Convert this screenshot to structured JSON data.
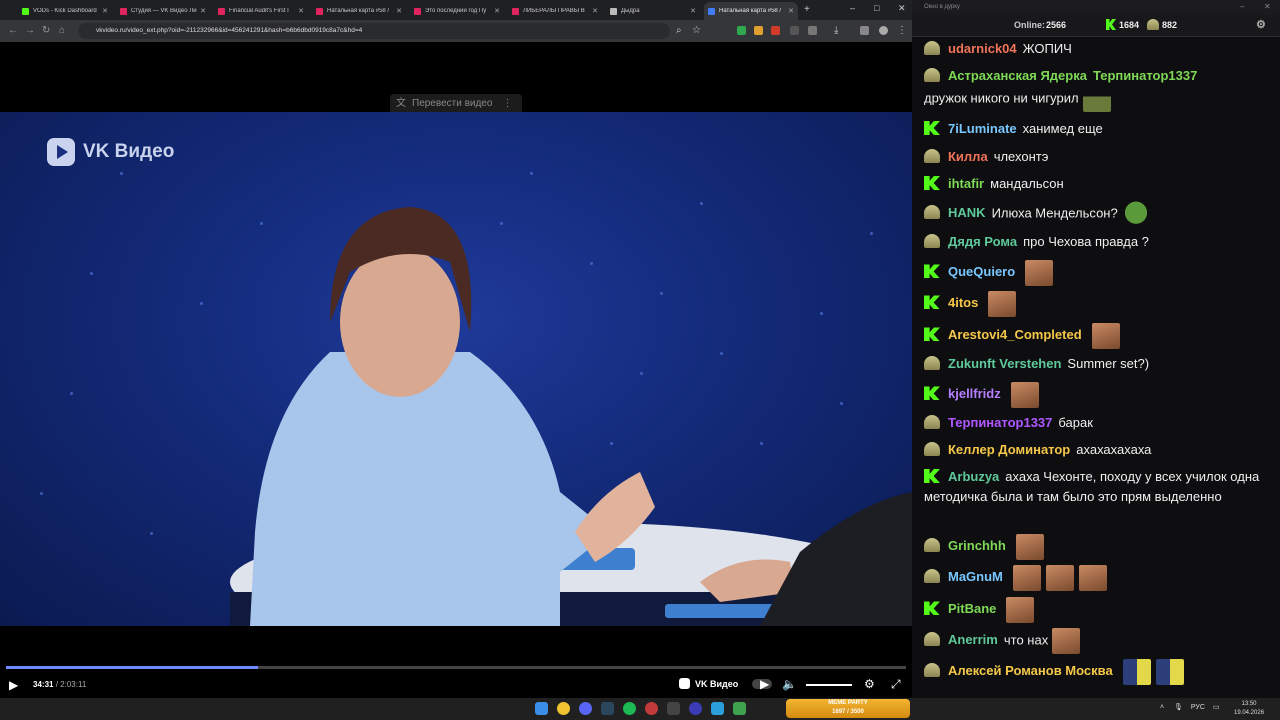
{
  "tabs": [
    {
      "label": "VODs - Kick Dashboard",
      "color": "#53fc18"
    },
    {
      "label": "Студия — VK Видео Ли",
      "color": "#e0245e"
    },
    {
      "label": "Financial Audit's First I",
      "color": "#e0245e"
    },
    {
      "label": "Натальная карта #58 /",
      "color": "#e0245e"
    },
    {
      "label": "Это последний год Пу",
      "color": "#e0245e"
    },
    {
      "label": "ЛИБЕРАЛЫ ПРАВЫ В",
      "color": "#e0245e"
    },
    {
      "label": "Дыдра",
      "color": "#bbbbbb"
    },
    {
      "label": "Натальная карта #58 /",
      "color": "#3f7cf5",
      "active": true
    }
  ],
  "new_tab": "+",
  "window_controls": {
    "minimize": "–",
    "maximize": "□",
    "close": "✕"
  },
  "address": {
    "url": "vkvideo.ru/video_ext.php?oid=-211232966&id=456241291&hash=b6b6dbd0919c8a7c&hd=4"
  },
  "video": {
    "translate_label": "Перевести видео",
    "logo_text": "VK Видео",
    "current_time": "34:31",
    "separator": "/",
    "duration": "2:03:11",
    "progress_fraction": 0.28,
    "brand_label": "VK Видео",
    "volume_fraction": 1.0
  },
  "chat": {
    "window_title": "Окно в дурку",
    "online_label": "Online:",
    "online_count": "2566",
    "kick_count": "1684",
    "helm_count": "882",
    "messages": [
      {
        "badge": "helm",
        "user": "udarnick04",
        "color": "#f0735a",
        "text": "ЖОПИЧ"
      },
      {
        "badge": "helm",
        "user": "Астраханская Ядерка",
        "color": "#7ed957",
        "text": "Терпинатор1337",
        "text_color": "#7ed957",
        "text2": "дружок никого ни чигурил",
        "emotes": [
          "tank"
        ]
      },
      {
        "badge": "kick",
        "user": "7iLuminate",
        "color": "#79c7ff",
        "text": "ханимед еще"
      },
      {
        "badge": "helm",
        "user": "Килла",
        "color": "#f0735a",
        "text": "члехонтэ"
      },
      {
        "badge": "kick",
        "user": "ihtafir",
        "color": "#7ed957",
        "text": "мандальсон"
      },
      {
        "badge": "helm",
        "user": "HANK",
        "color": "#5fc99a",
        "text": "Илюха Мендельсон?",
        "emotes": [
          "pepe"
        ]
      },
      {
        "badge": "helm",
        "user": "Дядя Рома",
        "color": "#5fc99a",
        "text": "про Чехова правда ?"
      },
      {
        "badge": "kick",
        "user": "QueQuiero",
        "color": "#79c7ff",
        "text": "",
        "emotes": [
          "face"
        ]
      },
      {
        "badge": "kick",
        "user": "4itos",
        "color": "#f5c84a",
        "text": "",
        "emotes": [
          "face"
        ]
      },
      {
        "badge": "kick",
        "user": "Arestovi4_Completed",
        "color": "#f5c84a",
        "text": "",
        "emotes": [
          "face"
        ]
      },
      {
        "badge": "helm",
        "user": "Zukunft Verstehen",
        "color": "#5fc99a",
        "text": "Summer set?)"
      },
      {
        "badge": "kick",
        "user": "kjellfridz",
        "color": "#b57dff",
        "text": "",
        "emotes": [
          "face"
        ]
      },
      {
        "badge": "helm",
        "user": "Терпинатор1337",
        "color": "#b057ff",
        "text": "барак"
      },
      {
        "badge": "helm",
        "user": "Келлер Доминатор",
        "color": "#f5c84a",
        "text": "ахахахахаха"
      },
      {
        "badge": "kick",
        "user": "Arbuzya",
        "color": "#5fc99a",
        "text": "ахаха Чехонте, походу у всех училок одна методичка была и там было это прям выделенно"
      },
      {
        "badge": "helm",
        "user": "Grinchhh",
        "color": "#7ed957",
        "text": "",
        "emotes": [
          "face"
        ]
      },
      {
        "badge": "helm",
        "user": "MaGnuM",
        "color": "#79c7ff",
        "text": "",
        "emotes": [
          "face",
          "face",
          "face"
        ]
      },
      {
        "badge": "kick",
        "user": "PitBane",
        "color": "#7ed957",
        "text": "",
        "emotes": [
          "face"
        ]
      },
      {
        "badge": "helm",
        "user": "Anerrim",
        "color": "#5fc99a",
        "text": "что нах",
        "emotes": [
          "face"
        ]
      },
      {
        "badge": "helm",
        "user": "Алексей Романов Москва",
        "color": "#f5c84a",
        "text": "",
        "emotes": [
          "duo",
          "duo"
        ]
      }
    ]
  },
  "taskbar": {
    "meme_title": "MEME PARTY",
    "meme_sub": "1697 / 3500",
    "lang": "РУС",
    "time": "13:50",
    "date": "19.04.2026"
  }
}
